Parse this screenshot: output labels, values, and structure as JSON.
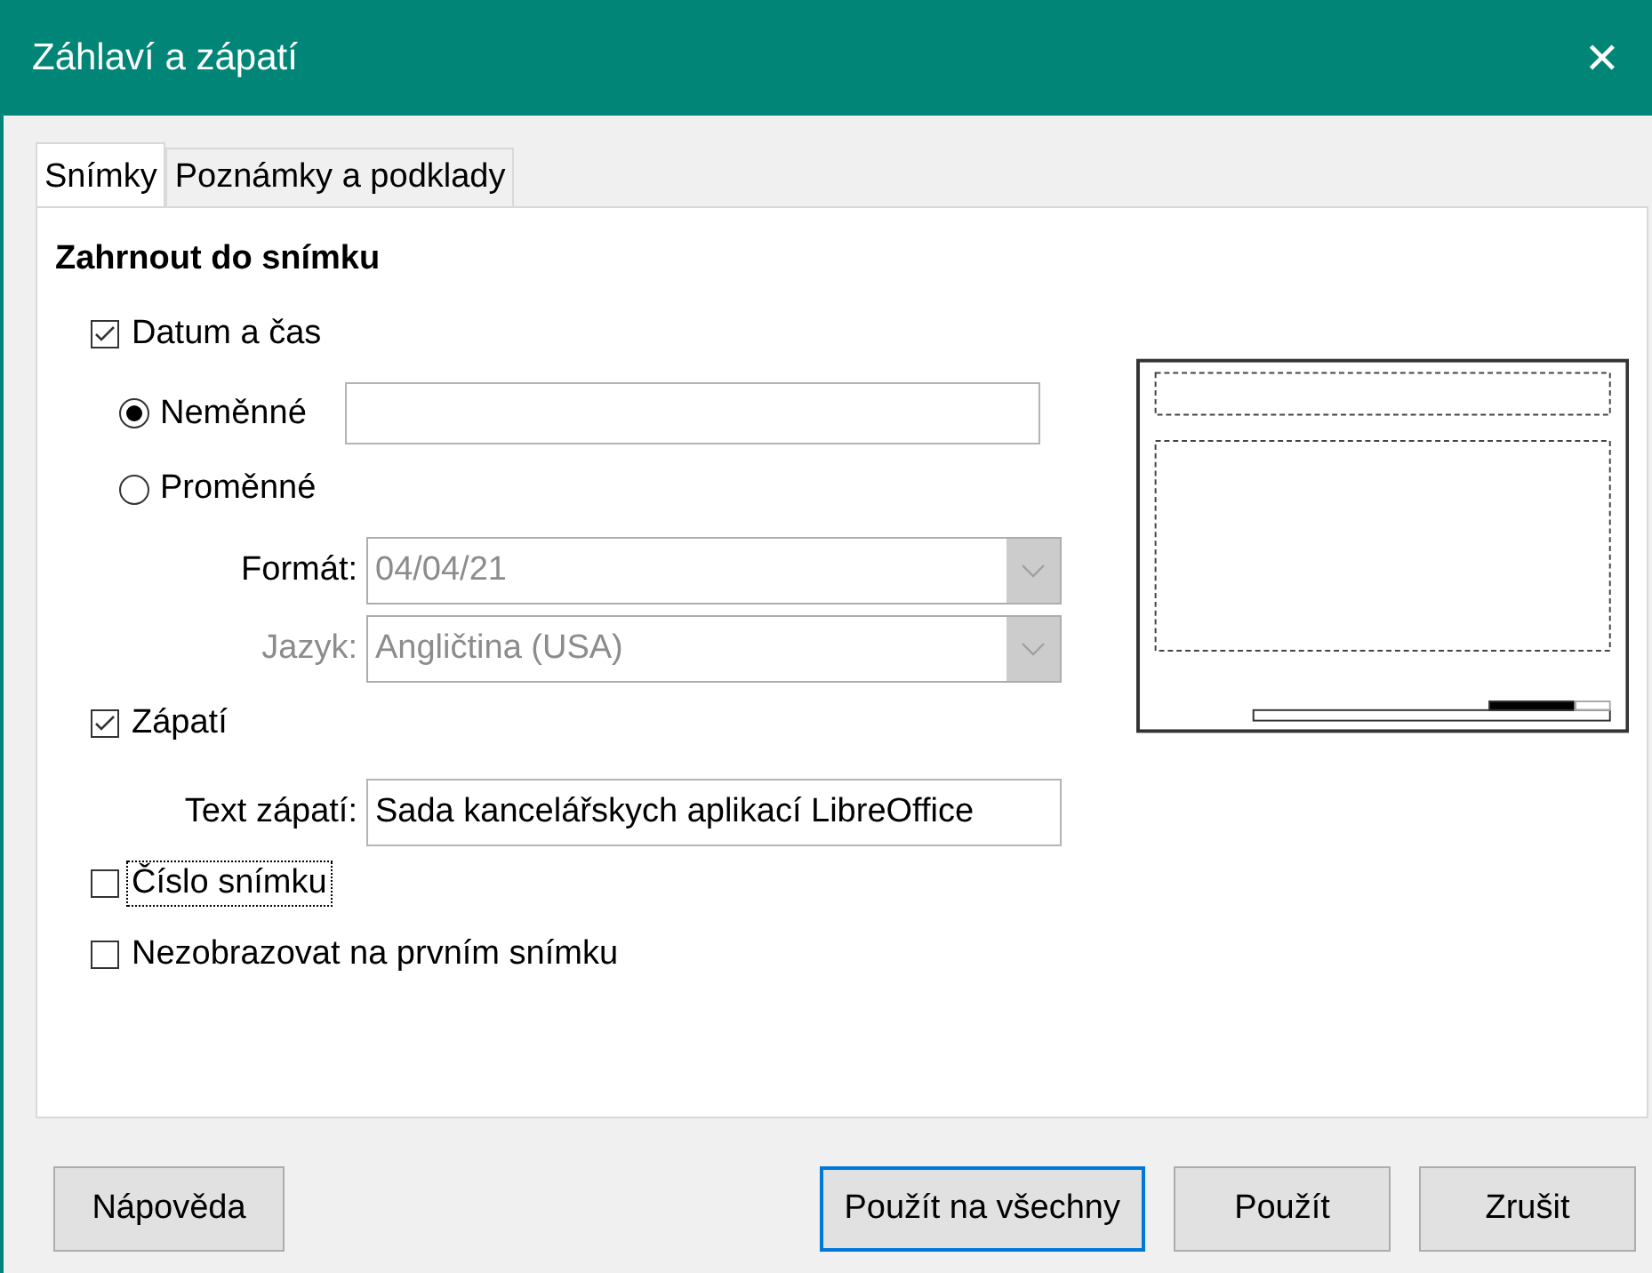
{
  "window": {
    "title": "Záhlaví a zápatí",
    "close": "✕"
  },
  "tabs": [
    {
      "label": "Snímky",
      "selected": true
    },
    {
      "label": "Poznámky a podklady",
      "selected": false
    }
  ],
  "section_title": "Zahrnout do snímku",
  "date_time": {
    "label": "Datum a čas",
    "checked": true,
    "fixed": {
      "label": "Neměnné",
      "selected": true
    },
    "variable": {
      "label": "Proměnné",
      "selected": false
    },
    "format": {
      "label": "Formát:",
      "value": "04/04/21",
      "disabled": true,
      "label_disabled": false
    },
    "language": {
      "label": "Jazyk:",
      "value": "Angličtina (USA)",
      "disabled": true,
      "label_disabled": true
    }
  },
  "footer": {
    "label": "Zápatí",
    "checked": true,
    "text_label": "Text zápatí:",
    "text_value": "Sada kancelářskych aplikací LibreOffice"
  },
  "slide_number": {
    "label": "Číslo snímku",
    "checked": false,
    "focused": true
  },
  "hide_first": {
    "label": "Nezobrazovat na prvním snímku",
    "checked": false
  },
  "buttons": [
    {
      "label": "Nápověda",
      "default": false
    },
    {
      "label": "Použít na všechny",
      "default": true
    },
    {
      "label": "Použít",
      "default": false
    },
    {
      "label": "Zrušit",
      "default": false
    }
  ]
}
